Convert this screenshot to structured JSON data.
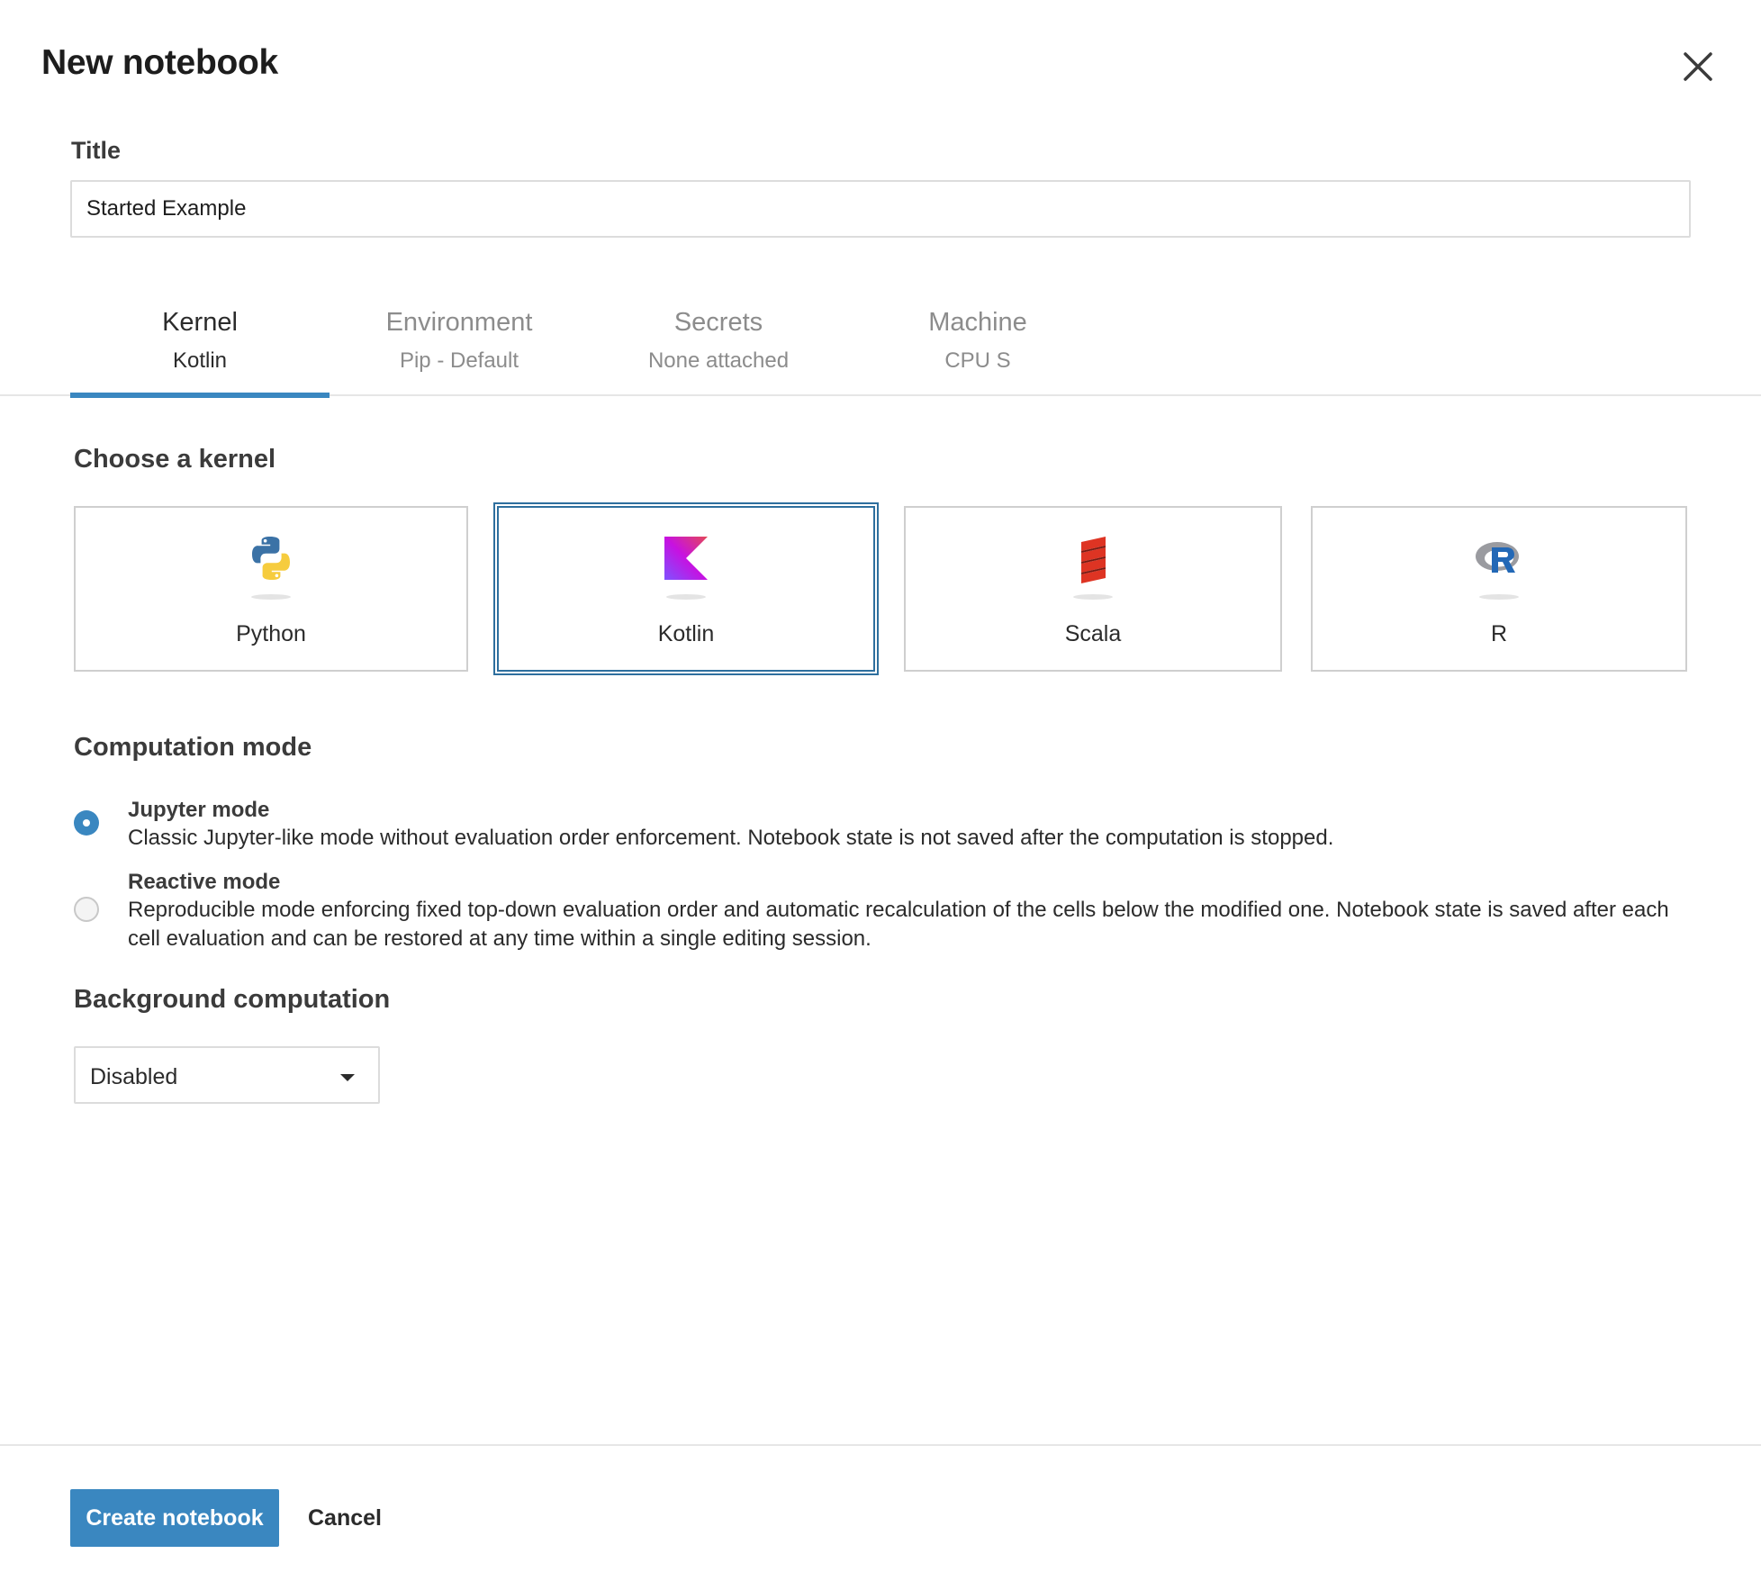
{
  "dialog": {
    "title": "New notebook",
    "close_icon": "close-icon"
  },
  "title_field": {
    "label": "Title",
    "value": "Started Example"
  },
  "tabs": [
    {
      "label": "Kernel",
      "sub": "Kotlin",
      "active": true
    },
    {
      "label": "Environment",
      "sub": "Pip - Default",
      "active": false
    },
    {
      "label": "Secrets",
      "sub": "None attached",
      "active": false
    },
    {
      "label": "Machine",
      "sub": "CPU S",
      "active": false
    }
  ],
  "kernel_section": {
    "heading": "Choose a kernel",
    "options": [
      {
        "label": "Python",
        "icon": "python-logo-icon",
        "selected": false
      },
      {
        "label": "Kotlin",
        "icon": "kotlin-logo-icon",
        "selected": true
      },
      {
        "label": "Scala",
        "icon": "scala-logo-icon",
        "selected": false
      },
      {
        "label": "R",
        "icon": "r-logo-icon",
        "selected": false
      }
    ]
  },
  "computation_mode": {
    "heading": "Computation mode",
    "modes": [
      {
        "title": "Jupyter mode",
        "description": "Classic Jupyter-like mode without evaluation order enforcement. Notebook state is not saved after the computation is stopped.",
        "checked": true
      },
      {
        "title": "Reactive mode",
        "description": "Reproducible mode enforcing fixed top-down evaluation order and automatic recalculation of the cells below the modified one. Notebook state is saved after each cell evaluation and can be restored at any time within a single editing session.",
        "checked": false
      }
    ]
  },
  "background_computation": {
    "heading": "Background computation",
    "selected": "Disabled"
  },
  "footer": {
    "create_label": "Create notebook",
    "cancel_label": "Cancel"
  },
  "colors": {
    "accent": "#3a87c0",
    "selected_border": "#2e6f9e"
  }
}
